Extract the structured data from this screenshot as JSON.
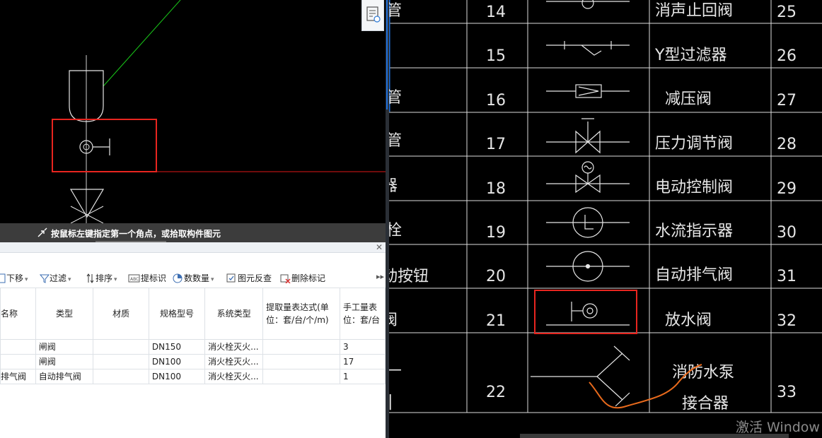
{
  "left_view": {
    "status_hint": "按鼠标左键指定第一个角点，或拾取构件图元"
  },
  "toolbar": {
    "move_down": "下移",
    "filter": "过滤",
    "sort": "排序",
    "mark_identify": "提标识",
    "count": "数数量",
    "element_check": "图元反查",
    "delete_mark": "删除标记"
  },
  "table": {
    "headers": [
      "名称",
      "类型",
      "材质",
      "规格型号",
      "系统类型",
      "提取量表达式(单位：套/台/个/m)",
      "手工量表位：套/台"
    ],
    "rows": [
      [
        "",
        "闸阀",
        "",
        "DN150",
        "消火栓灭火...",
        "",
        "3"
      ],
      [
        "",
        "闸阀",
        "",
        "DN100",
        "消火栓灭火...",
        "",
        "17"
      ],
      [
        "排气阀",
        "自动排气阀",
        "",
        "DN100",
        "消火栓灭火...",
        "",
        "1"
      ]
    ]
  },
  "legend": {
    "rows": [
      {
        "left_text": "管",
        "no": "14",
        "name": "消声止回阀",
        "right_no": "25"
      },
      {
        "left_text": "",
        "no": "15",
        "name": "Y型过滤器",
        "right_no": "26"
      },
      {
        "left_text": "管",
        "no": "16",
        "name": "减压阀",
        "right_no": "27"
      },
      {
        "left_text": "管",
        "no": "17",
        "name": "压力调节阀",
        "right_no": "28"
      },
      {
        "left_text": "器",
        "no": "18",
        "name": "电动控制阀",
        "right_no": "29"
      },
      {
        "left_text": "栓",
        "no": "19",
        "name": "水流指示器",
        "right_no": "30"
      },
      {
        "left_text": "动按钮",
        "no": "20",
        "name": "自动排气阀",
        "right_no": "31"
      },
      {
        "left_text": "阀",
        "no": "21",
        "name": "放水阀",
        "right_no": "32"
      },
      {
        "left_text": "",
        "no": "22",
        "name": "消防水泵接合器",
        "right_no": "33"
      }
    ],
    "pump_name_line1": "消防水泵",
    "pump_name_line2": "接合器"
  },
  "os_watermark": "激活 Window",
  "colors": {
    "highlight": "#e8251f",
    "cad_bg": "#000000",
    "sketch": "#e86a1c",
    "leader_line": "#19c819"
  }
}
